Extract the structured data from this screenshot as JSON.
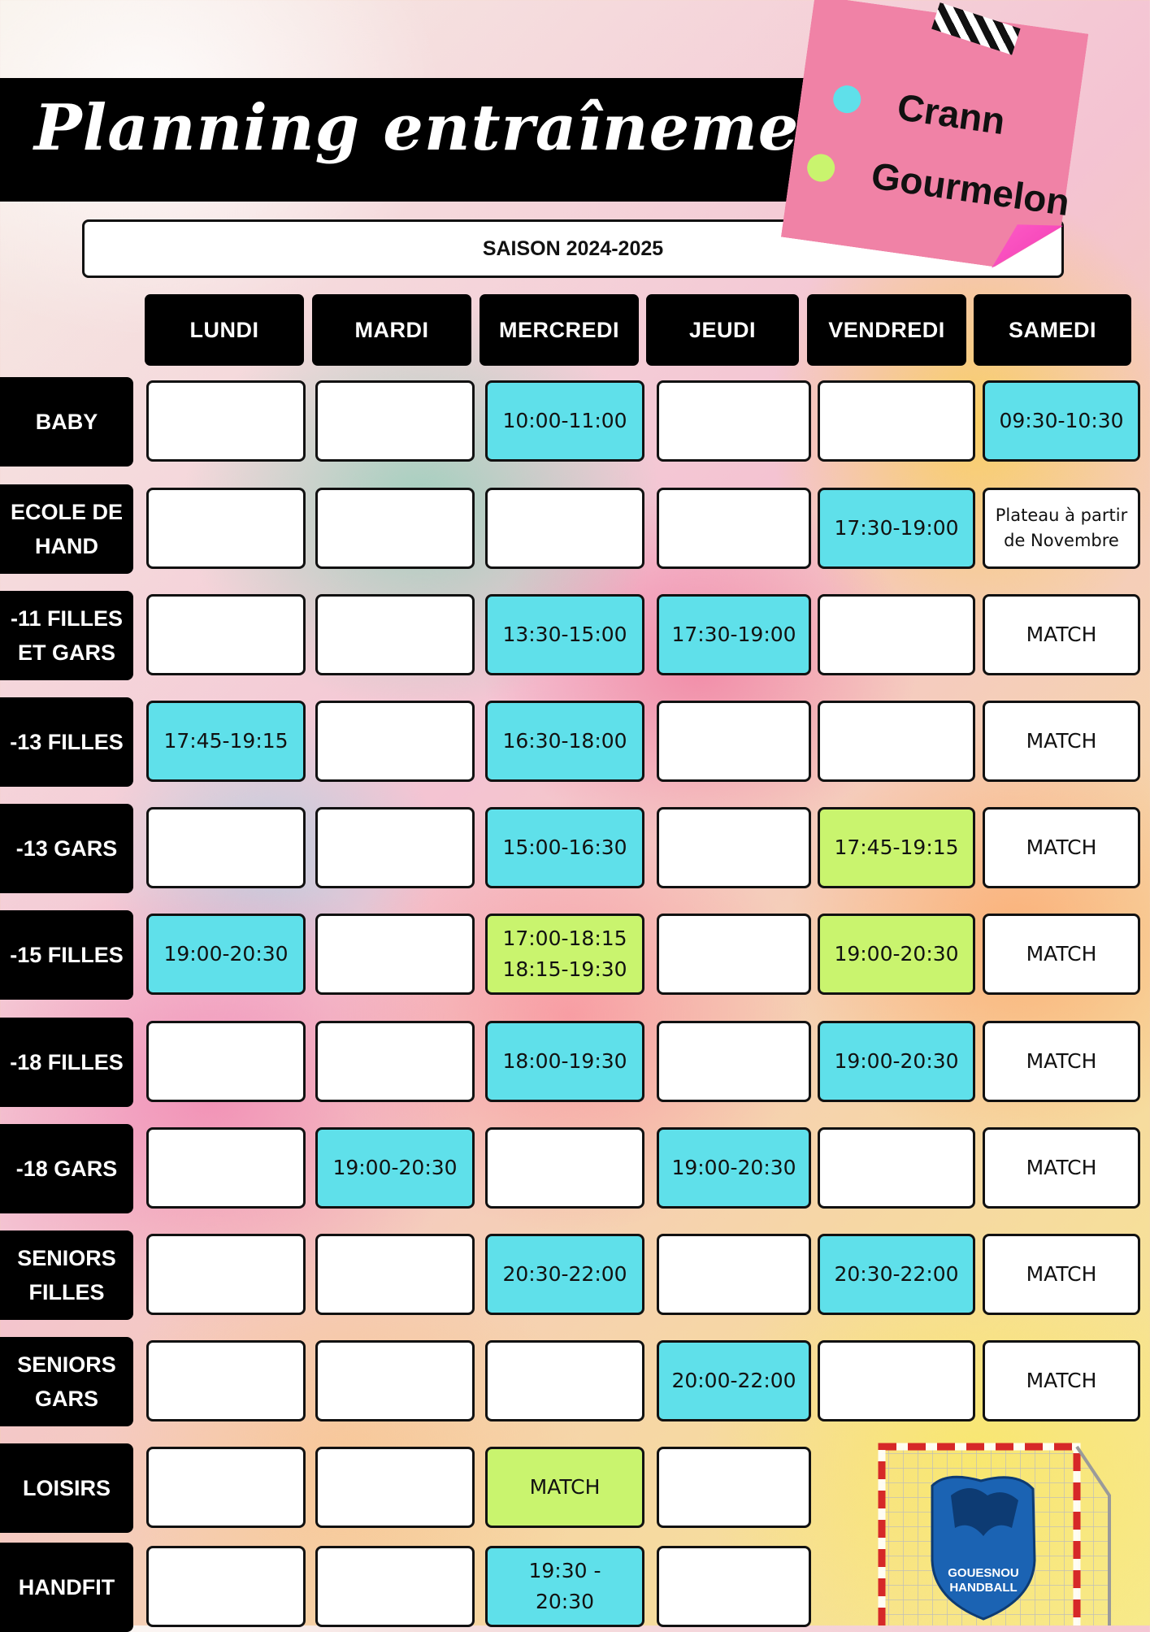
{
  "header": {
    "title": "Planning entraînements",
    "season": "SAISON 2024-2025"
  },
  "legend": [
    {
      "label": "Crann",
      "color": "#5fe0ea"
    },
    {
      "label": "Gourmelon",
      "color": "#c9f46e"
    }
  ],
  "colors": {
    "crann": "#5fe0ea",
    "gourmelon": "#c9f46e",
    "empty": "#ffffff"
  },
  "days": [
    "LUNDI",
    "MARDI",
    "MERCREDI",
    "JEUDI",
    "VENDREDI",
    "SAMEDI"
  ],
  "rows": [
    {
      "category": "BABY",
      "cells": [
        {
          "text": "",
          "color": "empty"
        },
        {
          "text": "",
          "color": "empty"
        },
        {
          "text": "10:00-11:00",
          "color": "crann"
        },
        {
          "text": "",
          "color": "empty"
        },
        {
          "text": "",
          "color": "empty"
        },
        {
          "text": "09:30-10:30",
          "color": "crann"
        }
      ]
    },
    {
      "category": "ECOLE DE\nHAND",
      "cells": [
        {
          "text": "",
          "color": "empty"
        },
        {
          "text": "",
          "color": "empty"
        },
        {
          "text": "",
          "color": "empty"
        },
        {
          "text": "",
          "color": "empty"
        },
        {
          "text": "17:30-19:00",
          "color": "crann"
        },
        {
          "text": "Plateau à partir\nde Novembre",
          "color": "empty"
        }
      ]
    },
    {
      "category": "-11 FILLES\nET GARS",
      "cells": [
        {
          "text": "",
          "color": "empty"
        },
        {
          "text": "",
          "color": "empty"
        },
        {
          "text": "13:30-15:00",
          "color": "crann"
        },
        {
          "text": "17:30-19:00",
          "color": "crann"
        },
        {
          "text": "",
          "color": "empty"
        },
        {
          "text": "MATCH",
          "color": "empty"
        }
      ]
    },
    {
      "category": "-13 FILLES",
      "cells": [
        {
          "text": "17:45-19:15",
          "color": "crann"
        },
        {
          "text": "",
          "color": "empty"
        },
        {
          "text": "16:30-18:00",
          "color": "crann"
        },
        {
          "text": "",
          "color": "empty"
        },
        {
          "text": "",
          "color": "empty"
        },
        {
          "text": "MATCH",
          "color": "empty"
        }
      ]
    },
    {
      "category": "-13 GARS",
      "cells": [
        {
          "text": "",
          "color": "empty"
        },
        {
          "text": "",
          "color": "empty"
        },
        {
          "text": "15:00-16:30",
          "color": "crann"
        },
        {
          "text": "",
          "color": "empty"
        },
        {
          "text": "17:45-19:15",
          "color": "gourmelon"
        },
        {
          "text": "MATCH",
          "color": "empty"
        }
      ]
    },
    {
      "category": "-15 FILLES",
      "cells": [
        {
          "text": "19:00-20:30",
          "color": "crann"
        },
        {
          "text": "",
          "color": "empty"
        },
        {
          "text": "17:00-18:15\n18:15-19:30",
          "color": "gourmelon"
        },
        {
          "text": "",
          "color": "empty"
        },
        {
          "text": "19:00-20:30",
          "color": "gourmelon"
        },
        {
          "text": "MATCH",
          "color": "empty"
        }
      ]
    },
    {
      "category": "-18 FILLES",
      "cells": [
        {
          "text": "",
          "color": "empty"
        },
        {
          "text": "",
          "color": "empty"
        },
        {
          "text": "18:00-19:30",
          "color": "crann"
        },
        {
          "text": "",
          "color": "empty"
        },
        {
          "text": "19:00-20:30",
          "color": "crann"
        },
        {
          "text": "MATCH",
          "color": "empty"
        }
      ]
    },
    {
      "category": "-18 GARS",
      "cells": [
        {
          "text": "",
          "color": "empty"
        },
        {
          "text": "19:00-20:30",
          "color": "crann"
        },
        {
          "text": "",
          "color": "empty"
        },
        {
          "text": "19:00-20:30",
          "color": "crann"
        },
        {
          "text": "",
          "color": "empty"
        },
        {
          "text": "MATCH",
          "color": "empty"
        }
      ]
    },
    {
      "category": "SENIORS\nFILLES",
      "cells": [
        {
          "text": "",
          "color": "empty"
        },
        {
          "text": "",
          "color": "empty"
        },
        {
          "text": "20:30-22:00",
          "color": "crann"
        },
        {
          "text": "",
          "color": "empty"
        },
        {
          "text": "20:30-22:00",
          "color": "crann"
        },
        {
          "text": "MATCH",
          "color": "empty"
        }
      ]
    },
    {
      "category": "SENIORS\nGARS",
      "cells": [
        {
          "text": "",
          "color": "empty"
        },
        {
          "text": "",
          "color": "empty"
        },
        {
          "text": "",
          "color": "empty"
        },
        {
          "text": "20:00-22:00",
          "color": "crann"
        },
        {
          "text": "",
          "color": "empty"
        },
        {
          "text": "MATCH",
          "color": "empty"
        }
      ]
    },
    {
      "category": "LOISIRS",
      "cells": [
        {
          "text": "",
          "color": "empty"
        },
        {
          "text": "",
          "color": "empty"
        },
        {
          "text": "MATCH",
          "color": "gourmelon"
        },
        {
          "text": "",
          "color": "empty"
        }
      ]
    },
    {
      "category": "HANDFIT",
      "cells": [
        {
          "text": "",
          "color": "empty"
        },
        {
          "text": "",
          "color": "empty"
        },
        {
          "text": "19:30 -\n20:30",
          "color": "crann"
        },
        {
          "text": "",
          "color": "empty"
        }
      ]
    }
  ],
  "logo": {
    "text": "GOUESNOU HANDBALL",
    "icon": "goal-with-lion-logo-icon"
  }
}
